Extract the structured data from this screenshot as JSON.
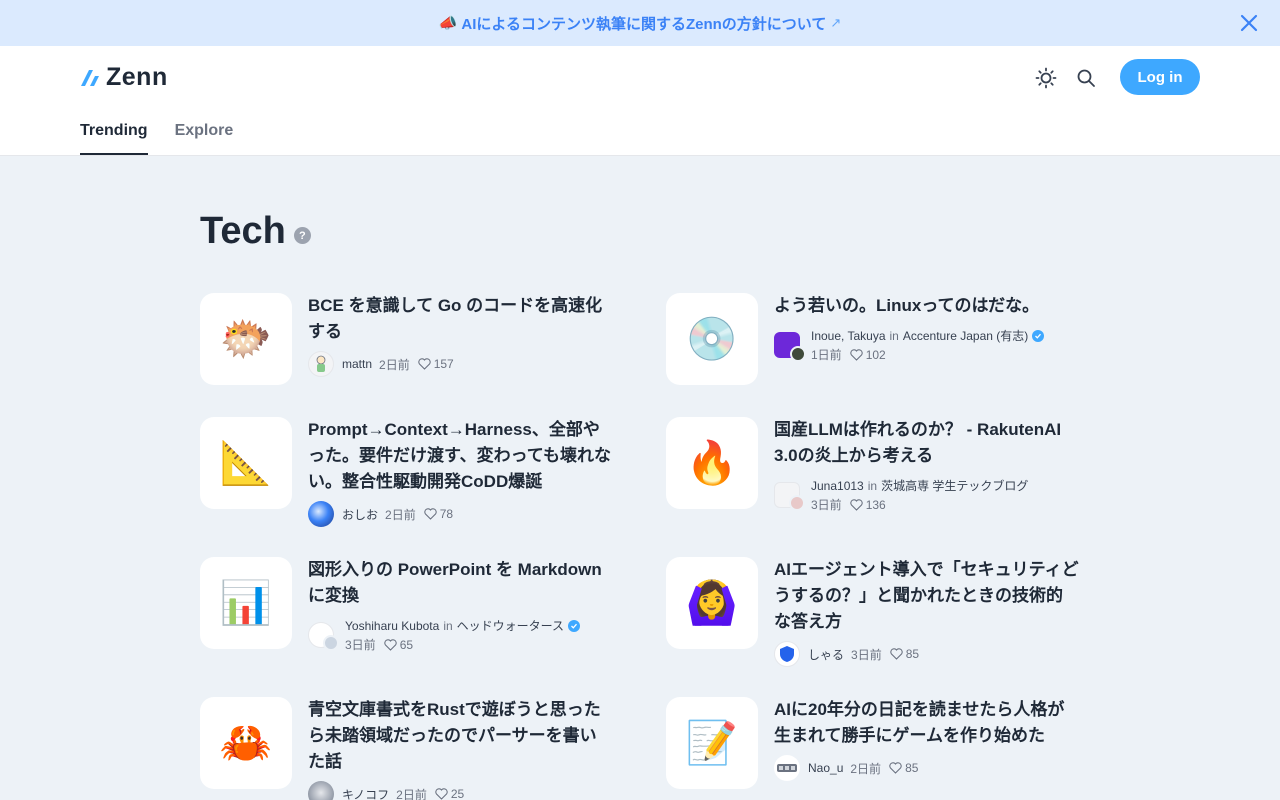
{
  "banner": {
    "icon": "📣",
    "text": "AIによるコンテンツ執筆に関するZennの方針について",
    "arrow": "↗"
  },
  "header": {
    "logo_text": "Zenn",
    "login_label": "Log in",
    "tabs": [
      {
        "label": "Trending",
        "active": true
      },
      {
        "label": "Explore",
        "active": false
      }
    ]
  },
  "section": {
    "title": "Tech",
    "help": "?"
  },
  "articles": [
    {
      "emoji": "🐡",
      "title": "BCE を意識して Go のコードを高速化する",
      "author": "mattn",
      "publication": "",
      "date": "2日前",
      "likes": "157"
    },
    {
      "emoji": "💿",
      "title": "よう若いの。Linuxってのはだな。",
      "author": "Inoue, Takuya",
      "in": "in",
      "publication": "Accenture Japan (有志)",
      "date": "1日前",
      "likes": "102"
    },
    {
      "emoji": "📐",
      "title": "Prompt→Context→Harness、全部やった。要件だけ渡す、変わっても壊れない。整合性駆動開発CoDD爆誕",
      "author": "おしお",
      "publication": "",
      "date": "2日前",
      "likes": "78"
    },
    {
      "emoji": "🔥",
      "title": "国産LLMは作れるのか？ - RakutenAI 3.0の炎上から考える",
      "author": "Juna1013",
      "in": "in",
      "publication": "茨城高専 学生テックブログ",
      "date": "3日前",
      "likes": "136"
    },
    {
      "emoji": "📊",
      "title": "図形入りの PowerPoint を Markdown に変換",
      "author": "Yoshiharu Kubota",
      "in": "in",
      "publication": "ヘッドウォータース",
      "date": "3日前",
      "likes": "65"
    },
    {
      "emoji": "🙆‍♀️",
      "title": "AIエージェント導入で「セキュリティどうするの？」と聞かれたときの技術的な答え方",
      "author": "しゃる",
      "publication": "",
      "date": "3日前",
      "likes": "85"
    },
    {
      "emoji": "🦀",
      "title": "青空文庫書式をRustで遊ぼうと思ったら未踏領域だったのでパーサーを書いた話",
      "author": "キノコフ",
      "publication": "",
      "date": "2日前",
      "likes": "25"
    },
    {
      "emoji": "📝",
      "title": "AIに20年分の日記を読ませたら人格が生まれて勝手にゲームを作り始めた",
      "author": "Nao_u",
      "publication": "",
      "date": "2日前",
      "likes": "85"
    }
  ]
}
